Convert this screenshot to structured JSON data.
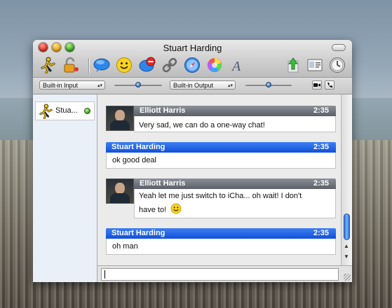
{
  "window": {
    "title": "Stuart Harding"
  },
  "toolbar": {
    "buttons": [
      {
        "name": "aim-buddy-icon"
      },
      {
        "name": "lock-icon"
      },
      {
        "name": "chat-bubble-icon"
      },
      {
        "name": "smiley-icon"
      },
      {
        "name": "block-icon"
      },
      {
        "name": "link-icon"
      },
      {
        "name": "safari-icon"
      },
      {
        "name": "color-wheel-icon"
      },
      {
        "name": "font-icon"
      },
      {
        "name": "send-file-icon"
      },
      {
        "name": "card-icon"
      },
      {
        "name": "clock-icon"
      }
    ]
  },
  "av_controls": {
    "input_label": "Built-in Input",
    "output_label": "Built-in Output",
    "input_volume": 0.5,
    "output_volume": 0.5
  },
  "sidebar": {
    "participant": {
      "name": "Stua...",
      "status": "available"
    }
  },
  "messages": [
    {
      "sender": "Elliott Harris",
      "time": "2:35",
      "lines": [
        "Very sad, we can do a one-way chat!"
      ]
    },
    {
      "sender": "Stuart Harding",
      "time": "2:35",
      "lines": [
        "ok good deal"
      ]
    },
    {
      "sender": "Elliott Harris",
      "time": "2:35",
      "lines": [
        "Yeah let me just switch to iCha... oh wait! I don't",
        "have to!"
      ]
    },
    {
      "sender": "Stuart Harding",
      "time": "2:35",
      "lines": [
        "oh man"
      ]
    }
  ],
  "input": {
    "value": ""
  },
  "colors": {
    "self_header": "#1f5fe8",
    "buddy_header": "#6b6f78",
    "status_available": "#3fa81f"
  }
}
